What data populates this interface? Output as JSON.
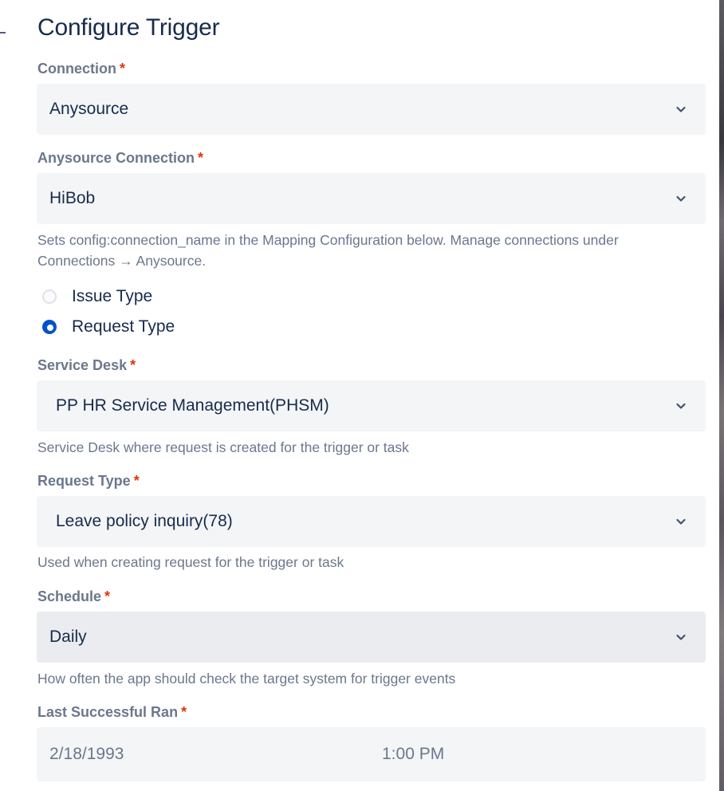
{
  "title": "Configure Trigger",
  "connection": {
    "label": "Connection",
    "required": "*",
    "value": "Anysource"
  },
  "anysource_connection": {
    "label": "Anysource Connection",
    "required": "*",
    "value": "HiBob",
    "help": "Sets config:connection_name in the Mapping Configuration below. Manage connections under Connections → Anysource."
  },
  "type_choice": {
    "options": [
      {
        "label": "Issue Type",
        "checked": false
      },
      {
        "label": "Request Type",
        "checked": true
      }
    ]
  },
  "service_desk": {
    "label": "Service Desk",
    "required": "*",
    "value": "PP HR Service Management(PHSM)",
    "help": "Service Desk where request is created for the trigger or task"
  },
  "request_type": {
    "label": "Request Type",
    "required": "*",
    "value": "Leave policy inquiry(78)",
    "help": "Used when creating request for the trigger or task"
  },
  "schedule": {
    "label": "Schedule",
    "required": "*",
    "value": "Daily",
    "help": "How often the app should check the target system for trigger events"
  },
  "last_successful_ran": {
    "label": "Last Successful Ran",
    "required": "*",
    "date": "2/18/1993",
    "time": "1:00 PM"
  },
  "icons": {
    "dropdown": "chevron-down-icon",
    "radio_checked": "radio-checked-icon",
    "radio_unchecked": "radio-unchecked-icon"
  },
  "colors": {
    "accent": "#0052cc",
    "required": "#de350b",
    "label": "#6b778c",
    "text": "#172b4d",
    "field_bg": "#f4f5f7"
  }
}
